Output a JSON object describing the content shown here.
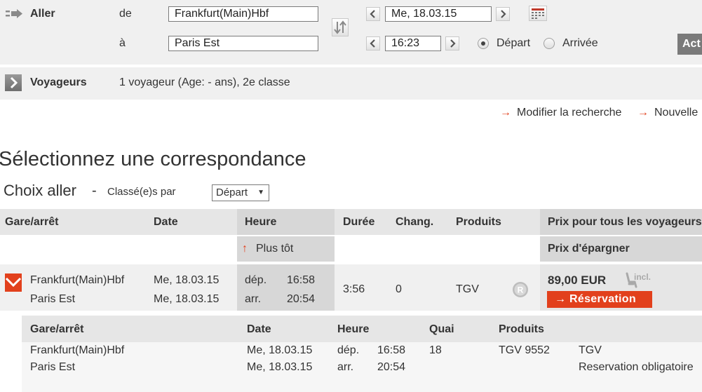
{
  "search": {
    "outbound_label": "Aller",
    "from_label": "de",
    "to_label": "à",
    "from_value": "Frankfurt(Main)Hbf",
    "to_value": "Paris Est",
    "date_value": "Me, 18.03.15",
    "time_value": "16:23",
    "departure_label": "Départ",
    "arrival_label": "Arrivée",
    "time_mode_selected": "departure",
    "action_button_label": "Act"
  },
  "travellers": {
    "label": "Voyageurs",
    "summary": "1 voyageur (Age: - ans), 2e classe"
  },
  "links": {
    "modify_search": "Modifier la recherche",
    "new_search": "Nouvelle"
  },
  "page_title": "Sélectionnez une correspondance",
  "subtitle": {
    "outbound": "Choix aller",
    "dash": "-",
    "sorted_by_label": "Classé(e)s par",
    "sort_value": "Départ"
  },
  "results_table": {
    "headers": {
      "station": "Gare/arrêt",
      "date": "Date",
      "time": "Heure",
      "duration": "Durée",
      "changes": "Chang.",
      "products": "Produits",
      "price": "Prix pour tous les voyageurs"
    },
    "earlier_label": "Plus tôt",
    "price_type": "Prix d'épargner",
    "connection": {
      "from_station": "Frankfurt(Main)Hbf",
      "to_station": "Paris Est",
      "dep_date": "Me, 18.03.15",
      "arr_date": "Me, 18.03.15",
      "dep_label": "dép.",
      "arr_label": "arr.",
      "dep_time": "16:58",
      "arr_time": "20:54",
      "duration": "3:56",
      "changes": "0",
      "product": "TGV",
      "price": "89,00 EUR",
      "seat_badge": "incl.",
      "reserve_button": "Réservation"
    }
  },
  "details": {
    "headers": {
      "station": "Gare/arrêt",
      "date": "Date",
      "time": "Heure",
      "platform": "Quai",
      "products": "Produits"
    },
    "rows": [
      {
        "station": "Frankfurt(Main)Hbf",
        "date": "Me, 18.03.15",
        "label": "dép.",
        "time": "16:58",
        "platform": "18",
        "train": "TGV 9552",
        "info": "TGV"
      },
      {
        "station": "Paris Est",
        "date": "Me, 18.03.15",
        "label": "arr.",
        "time": "20:54",
        "platform": "",
        "train": "",
        "info": "Reservation obligatoire"
      }
    ]
  },
  "colors": {
    "accent": "#e2401c",
    "panel_bg": "#f0f0f0",
    "header_bg": "#e6e6e6",
    "highlight_bg": "#d7d7d7"
  }
}
